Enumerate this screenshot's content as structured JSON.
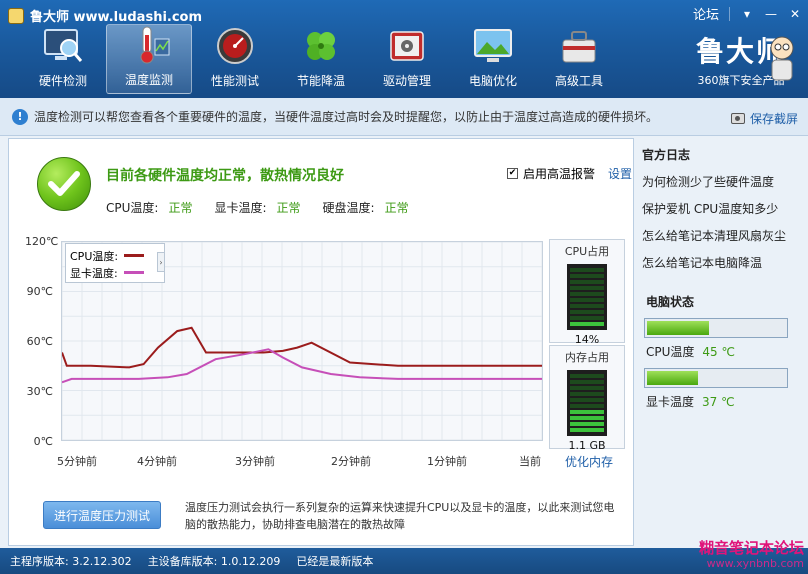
{
  "app": {
    "title": "鲁大师 www.ludashi.com"
  },
  "window": {
    "forum": "论坛"
  },
  "nav": [
    {
      "label": "硬件检测",
      "icon": "monitor-magnifier-icon",
      "active": false
    },
    {
      "label": "温度监测",
      "icon": "thermometer-icon",
      "active": true
    },
    {
      "label": "性能测试",
      "icon": "speedometer-icon",
      "active": false
    },
    {
      "label": "节能降温",
      "icon": "clover-icon",
      "active": false
    },
    {
      "label": "驱动管理",
      "icon": "toolbox-gear-icon",
      "active": false
    },
    {
      "label": "电脑优化",
      "icon": "monitor-landscape-icon",
      "active": false
    },
    {
      "label": "高级工具",
      "icon": "toolbox-icon",
      "active": false
    }
  ],
  "brand": {
    "logo": "鲁大师",
    "sub": "360旗下安全产品"
  },
  "infobar": {
    "text": "温度检测可以帮您查看各个重要硬件的温度，当硬件温度过高时会及时提醒您，以防止由于温度过高造成的硬件损坏。",
    "snapshot": "保存截屏"
  },
  "status": {
    "title": "目前各硬件温度均正常，散热情况良好",
    "cpu_label": "CPU温度:",
    "cpu_value": "正常",
    "gpu_label": "显卡温度:",
    "gpu_value": "正常",
    "disk_label": "硬盘温度:",
    "disk_value": "正常",
    "alarm_label": "启用高温报警",
    "alarm_checked": true,
    "settings": "设置"
  },
  "chart_data": {
    "type": "line",
    "x_tick_labels": [
      "5分钟前",
      "4分钟前",
      "3分钟前",
      "2分钟前",
      "1分钟前",
      "当前"
    ],
    "y_tick_labels": [
      "120℃",
      "90℃",
      "60℃",
      "30℃",
      "0℃"
    ],
    "ylim": [
      0,
      120
    ],
    "xlim": [
      -5,
      0
    ],
    "series": [
      {
        "name": "CPU温度:",
        "color": "#9b1c1c",
        "x": [
          -5.0,
          -4.95,
          -4.7,
          -4.3,
          -4.15,
          -4.0,
          -3.8,
          -3.65,
          -3.5,
          -3.2,
          -2.9,
          -2.7,
          -2.55,
          -2.4,
          -2.0,
          -1.5,
          -1.0,
          -0.5,
          -0.2,
          0.0
        ],
        "y": [
          53,
          45,
          45,
          44,
          46,
          56,
          66,
          68,
          53,
          53,
          53,
          54,
          56,
          59,
          47,
          45,
          45,
          45,
          45,
          45
        ]
      },
      {
        "name": "显卡温度:",
        "color": "#c64fb8",
        "x": [
          -5.0,
          -4.9,
          -4.6,
          -4.2,
          -3.9,
          -3.7,
          -3.4,
          -3.1,
          -2.85,
          -2.7,
          -2.5,
          -2.2,
          -1.9,
          -1.5,
          -1.0,
          -0.5,
          0.0
        ],
        "y": [
          35,
          37,
          37,
          37,
          38,
          40,
          49,
          52,
          55,
          50,
          44,
          40,
          38,
          37,
          37,
          37,
          37
        ]
      }
    ]
  },
  "usage": {
    "cpu_title": "CPU占用",
    "cpu_value": "14%",
    "cpu_fraction": 0.14,
    "mem_title": "内存占用",
    "mem_value": "1.1 GB",
    "mem_fraction": 0.35,
    "optimize": "优化内存"
  },
  "stress": {
    "button": "进行温度压力测试",
    "desc": "温度压力测试会执行一系列复杂的运算来快速提升CPU以及显卡的温度，以此来测试您电脑的散热能力，协助排查电脑潜在的散热故障"
  },
  "right": {
    "title": "官方日志",
    "links": [
      "为何检测少了些硬件温度",
      "保护爱机 CPU温度知多少",
      "怎么给笔记本清理风扇灰尘",
      "怎么给笔记本电脑降温"
    ],
    "status_title": "电脑状态",
    "cpu_label": "CPU温度",
    "cpu_temp": "45 ℃",
    "cpu_fraction": 0.45,
    "gpu_label": "显卡温度",
    "gpu_temp": "37 ℃",
    "gpu_fraction": 0.37
  },
  "footer": {
    "main_version": "主程序版本: 3.2.12.302",
    "db_version": "主设备库版本: 1.0.12.209",
    "latest": "已经是最新版本"
  },
  "watermark": {
    "text": "糊音笔记本论坛",
    "url": "www.xynbnb.com"
  }
}
